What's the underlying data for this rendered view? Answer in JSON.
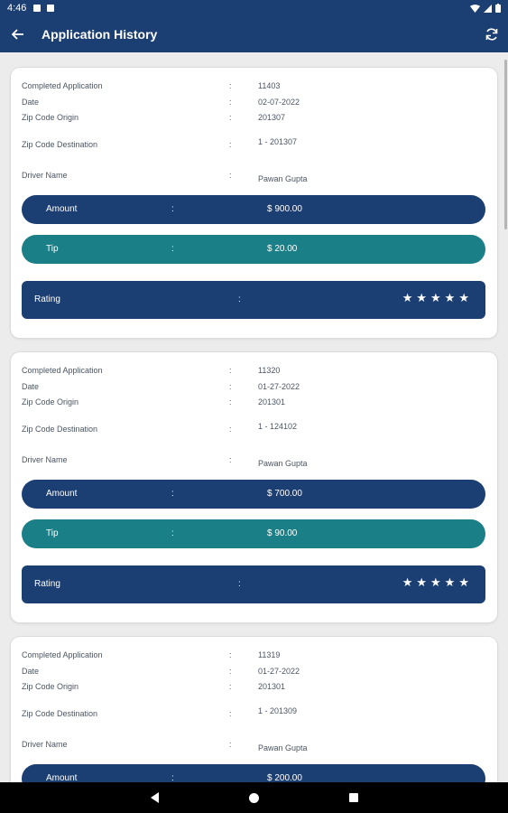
{
  "status": {
    "time": "4:46"
  },
  "appbar": {
    "title": "Application History"
  },
  "labels": {
    "completed": "Completed Application",
    "date": "Date",
    "zip_origin": "Zip Code Origin",
    "zip_dest": "Zip Code Destination",
    "driver": "Driver Name",
    "amount": "Amount",
    "tip": "Tip",
    "rating": "Rating",
    "colon": ":"
  },
  "cards": [
    {
      "id": "11403",
      "date": "02-07-2022",
      "zip_origin": "201307",
      "zip_dest": "1 - 201307",
      "driver": "Pawan Gupta",
      "amount": "$ 900.00",
      "tip": "$ 20.00",
      "rating": 5,
      "stars": "★★★★★"
    },
    {
      "id": "11320",
      "date": "01-27-2022",
      "zip_origin": "201301",
      "zip_dest": "1 - 124102",
      "driver": "Pawan Gupta",
      "amount": "$ 700.00",
      "tip": "$ 90.00",
      "rating": 5,
      "stars": "★★★★★"
    },
    {
      "id": "11319",
      "date": "01-27-2022",
      "zip_origin": "201301",
      "zip_dest": "1 - 201309",
      "driver": "Pawan Gupta",
      "amount": "$ 200.00"
    }
  ],
  "colors": {
    "primary": "#1c3f73",
    "tip": "#1a7f86",
    "background": "#ececec"
  }
}
